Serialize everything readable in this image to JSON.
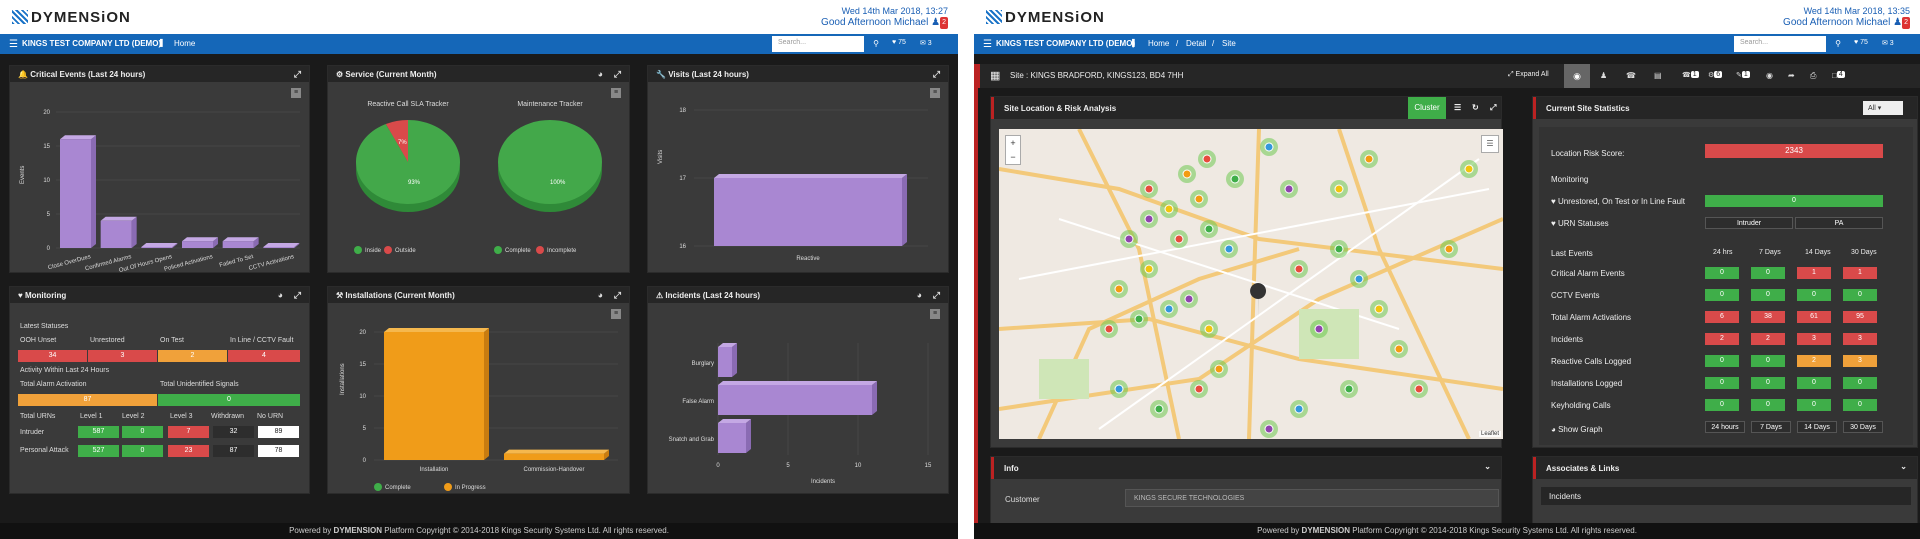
{
  "left": {
    "brand": "DYMENSiON",
    "date": "Wed 14th Mar 2018, 13:27",
    "greeting": "Good Afternoon Michael",
    "user_badge": "2",
    "company": "KINGS TEST COMPANY LTD (DEMO)",
    "nav_home": "Home",
    "search_placeholder": "Search...",
    "fav_count": "♥ 75",
    "msg_count": "✉ 3",
    "panels": {
      "critical": {
        "title": "Critical Events (Last 24 hours)",
        "ylabel": "Events"
      },
      "service": {
        "title": "Service (Current Month)",
        "pie1_title": "Reactive Call SLA Tracker",
        "pie2_title": "Maintenance Tracker",
        "pie1_small": "7%",
        "pie1_big": "93%",
        "pie2_big": "100%",
        "leg1a": "Inside",
        "leg1b": "Outside",
        "leg2a": "Complete",
        "leg2b": "Incomplete"
      },
      "visits": {
        "title": "Visits (Last 24 hours)",
        "ylabel": "Visits"
      },
      "monitoring": {
        "title": "Monitoring",
        "latest": "Latest Statuses",
        "h_ooh": "OOH Unset",
        "h_unrest": "Unrestored",
        "h_ontest": "On Test",
        "h_inline": "In Line / CCTV Fault",
        "v_ooh": "34",
        "v_unrest": "3",
        "v_ontest": "2",
        "v_inline": "4",
        "activity": "Activity Within Last 24 Hours",
        "h_alarm": "Total Alarm Activation",
        "h_unident": "Total Unidentified Signals",
        "v_alarm": "87",
        "v_unident": "0",
        "h_urns": "Total URNs",
        "h_l1": "Level 1",
        "h_l2": "Level 2",
        "h_l3": "Level 3",
        "h_withdrawn": "Withdrawn",
        "h_nourn": "No URN",
        "r1": "Intruder",
        "r1_l1": "587",
        "r1_l2": "0",
        "r1_l3": "7",
        "r1_w": "32",
        "r1_n": "89",
        "r2": "Personal Attack",
        "r2_l1": "527",
        "r2_l2": "0",
        "r2_l3": "23",
        "r2_w": "87",
        "r2_n": "78"
      },
      "installations": {
        "title": "Installations (Current Month)",
        "ylabel": "Installations",
        "leg_a": "Complete",
        "leg_b": "In Progress"
      },
      "incidents": {
        "title": "Incidents (Last 24 hours)",
        "xlabel": "Incidents"
      }
    },
    "footer_pre": "Powered by",
    "footer_brand": "DYMENSION",
    "footer_text": "Platform Copyright © 2014-2018 Kings Security Systems Ltd. All rights reserved."
  },
  "right": {
    "brand": "DYMENSiON",
    "date": "Wed 14th Mar 2018, 13:35",
    "greeting": "Good Afternoon Michael",
    "user_badge": "2",
    "company": "KINGS TEST COMPANY LTD (DEMO)",
    "bc_home": "Home",
    "bc_sep1": "/",
    "bc_detail": "Detail",
    "bc_sep2": "/",
    "bc_site": "Site",
    "search_placeholder": "Search...",
    "fav_count": "♥ 75",
    "msg_count": "✉ 3",
    "site_title": "Site : KINGS BRADFORD, KINGS123, BD4 7HH",
    "expand": "Expand All",
    "toolbar_counts": [
      "1",
      "6",
      "1",
      "4"
    ],
    "map_title": "Site Location & Risk Analysis",
    "cluster": "Cluster",
    "leaflet": "Leaflet",
    "stats_title": "Current Site Statistics",
    "filter": "All",
    "risk_label": "Location Risk Score:",
    "risk_value": "2343",
    "monitoring": "Monitoring",
    "unrestored_label": "Unrestored, On Test or In Line Fault",
    "unrestored_value": "0",
    "urn_label": "URN Statuses",
    "urn_a": "Intruder",
    "urn_b": "PA",
    "last_events": "Last Events",
    "cols": [
      "24 hrs",
      "7 Days",
      "14 Days",
      "30 Days"
    ],
    "rows": [
      {
        "label": "Critical Alarm Events",
        "v": [
          "0",
          "0",
          "1",
          "1"
        ]
      },
      {
        "label": "CCTV Events",
        "v": [
          "0",
          "0",
          "0",
          "0"
        ]
      },
      {
        "label": "Total Alarm Activations",
        "v": [
          "6",
          "38",
          "61",
          "95"
        ]
      },
      {
        "label": "Incidents",
        "v": [
          "2",
          "2",
          "3",
          "3"
        ]
      },
      {
        "label": "Reactive Calls Logged",
        "v": [
          "0",
          "0",
          "2",
          "3"
        ]
      },
      {
        "label": "Installations Logged",
        "v": [
          "0",
          "0",
          "0",
          "0"
        ]
      },
      {
        "label": "Keyholding Calls",
        "v": [
          "0",
          "0",
          "0",
          "0"
        ]
      }
    ],
    "show_graph": "Show Graph",
    "graph_btns": [
      "24 hours",
      "7 Days",
      "14 Days",
      "30 Days"
    ],
    "info": "Info",
    "customer_label": "Customer",
    "customer_value": "KINGS SECURE TECHNOLOGIES",
    "associates": "Associates & Links",
    "incidents_tab": "Incidents",
    "footer_pre": "Powered by",
    "footer_brand": "DYMENSION",
    "footer_text": "Platform Copyright © 2014-2018 Kings Security Systems Ltd. All rights reserved.",
    "colors": {
      "red": "#d94a4a",
      "green": "#3fae49",
      "orange": "#f0a13a"
    }
  },
  "chart_data": [
    {
      "type": "bar",
      "title": "Critical Events (Last 24 hours)",
      "ylabel": "Events",
      "categories": [
        "Close OverDues",
        "Confirmed Alarms",
        "Out Of Hours Opens",
        "Policed Activations",
        "Failed To Set",
        "CCTV Activations"
      ],
      "values": [
        16,
        4,
        0,
        1,
        1,
        0
      ],
      "ylim": [
        0,
        20
      ],
      "yticks": [
        "0",
        "5",
        "10",
        "15",
        "20"
      ]
    },
    {
      "type": "pie",
      "title": "Reactive Call SLA Tracker",
      "labels": [
        "Inside",
        "Outside"
      ],
      "values": [
        93,
        7
      ]
    },
    {
      "type": "pie",
      "title": "Maintenance Tracker",
      "labels": [
        "Complete",
        "Incomplete"
      ],
      "values": [
        100,
        0
      ]
    },
    {
      "type": "bar",
      "title": "Visits (Last 24 hours)",
      "ylabel": "Visits",
      "categories": [
        "Reactive"
      ],
      "values": [
        17
      ],
      "ylim": [
        16,
        18
      ],
      "yticks": [
        "16",
        "17",
        "18"
      ]
    },
    {
      "type": "bar",
      "title": "Installations (Current Month)",
      "ylabel": "Installations",
      "categories": [
        "Installation",
        "Commission-Handover"
      ],
      "series": [
        {
          "name": "Complete",
          "values": [
            20,
            0
          ]
        },
        {
          "name": "In Progress",
          "values": [
            0,
            1
          ]
        }
      ],
      "ylim": [
        0,
        20
      ],
      "yticks": [
        "0",
        "5",
        "10",
        "15",
        "20"
      ]
    },
    {
      "type": "bar",
      "title": "Incidents (Last 24 hours)",
      "xlabel": "Incidents",
      "categories": [
        "Burglary",
        "False Alarm",
        "Snatch and Grab"
      ],
      "values": [
        1,
        11,
        2
      ],
      "xlim": [
        0,
        15
      ],
      "xticks": [
        "0",
        "5",
        "10",
        "15"
      ]
    }
  ]
}
